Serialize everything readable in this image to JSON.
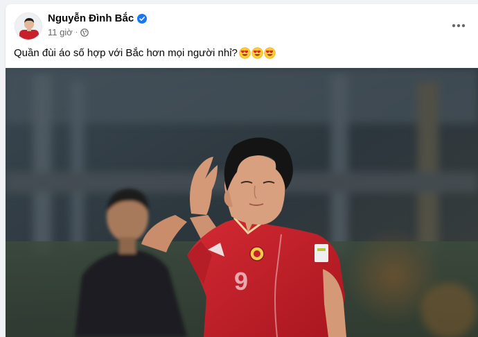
{
  "post": {
    "author": "Nguyễn Đình Bắc",
    "time": "11 giờ",
    "caption": "Quần đùi áo số hợp với Bắc hơn mọi người nhỉ?",
    "emoji_icon": "heart-eyes-emoji",
    "emoji_count": 3,
    "verified_icon": "verified-badge-icon",
    "audience_icon": "globe-icon",
    "menu_icon": "more-horizontal-icon"
  },
  "photo": {
    "jersey_number": "9",
    "colors": {
      "jersey": "#c8202a",
      "background": "#2f3a42"
    }
  },
  "colors": {
    "verified": "#1877f2",
    "secondary_text": "#65676b",
    "page_bg": "#f0f2f5"
  }
}
